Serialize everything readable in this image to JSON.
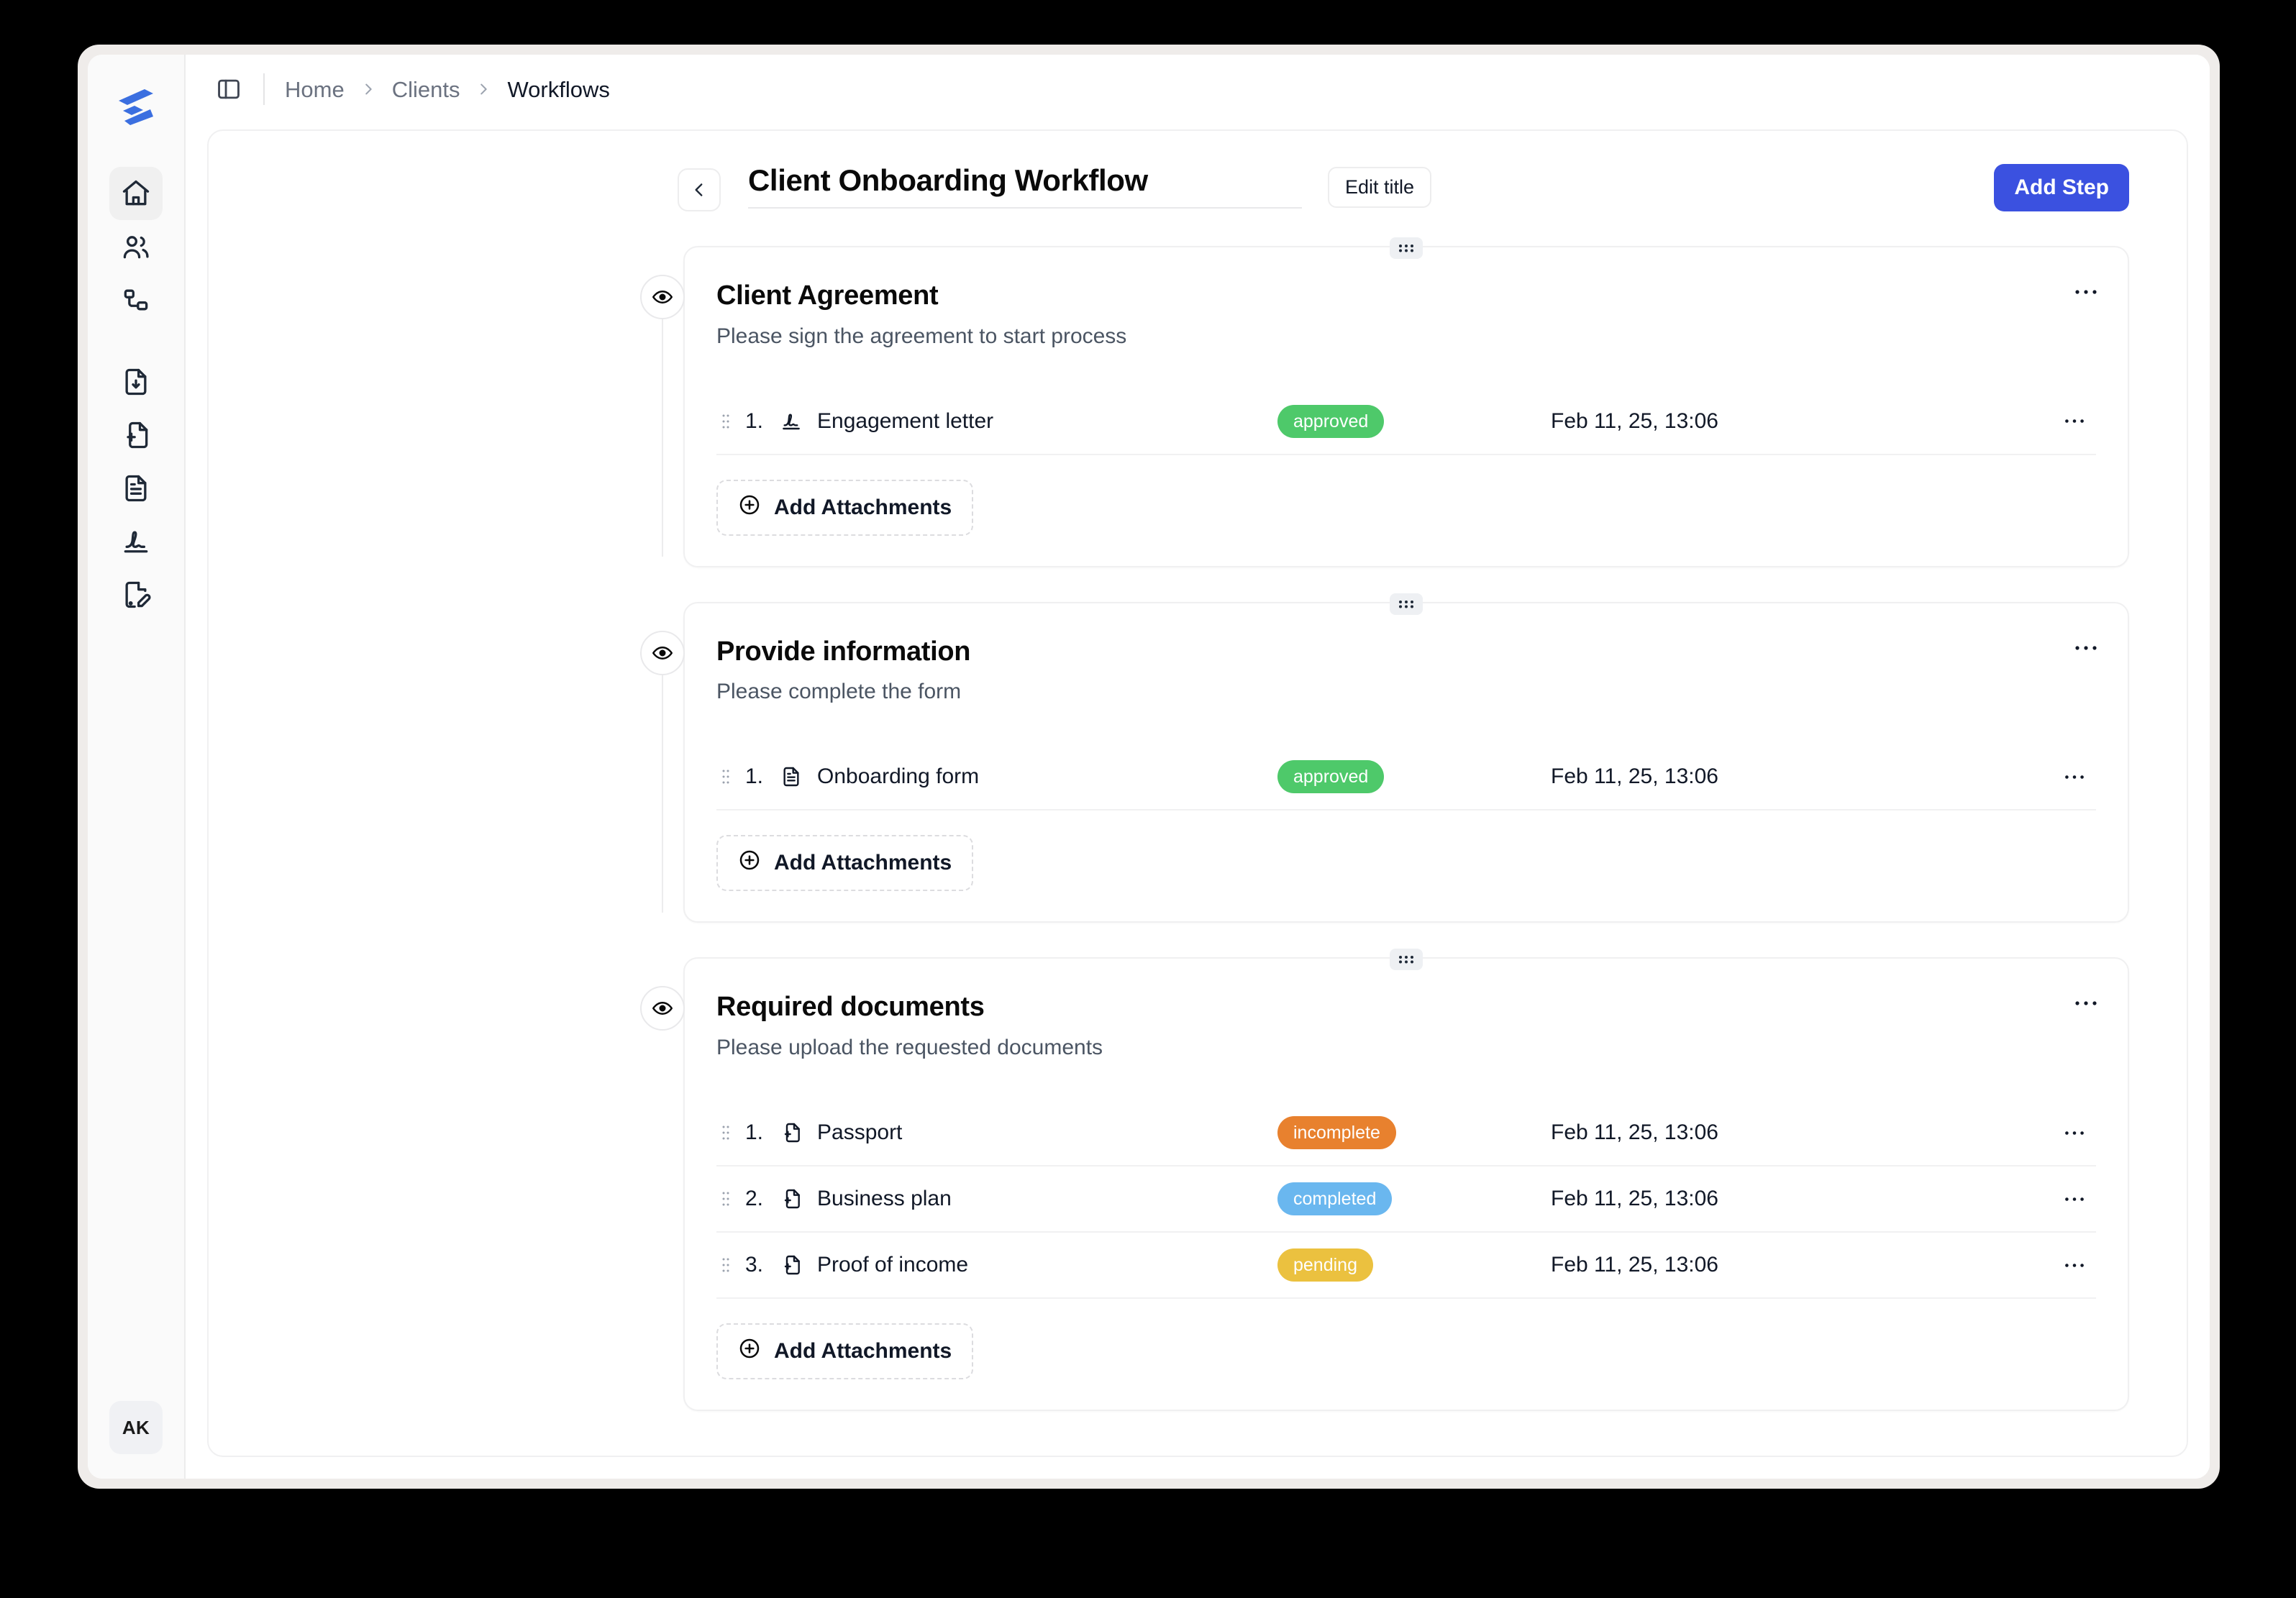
{
  "app": {
    "logo_name": "stacked-chevrons-logo",
    "accent_color": "#3b51e0",
    "user_initials": "AK"
  },
  "sidebar": {
    "items": [
      {
        "icon": "home-icon",
        "name": "home",
        "active": true
      },
      {
        "icon": "users-icon",
        "name": "clients",
        "active": false
      },
      {
        "icon": "workflow-nodes-icon",
        "name": "workflows",
        "active": false
      },
      {
        "icon": "file-download-icon",
        "name": "file-requests",
        "active": false
      },
      {
        "icon": "file-plus-icon",
        "name": "new-document",
        "active": false
      },
      {
        "icon": "file-text-icon",
        "name": "forms",
        "active": false
      },
      {
        "icon": "signature-icon",
        "name": "signatures",
        "active": false
      },
      {
        "icon": "file-edit-icon",
        "name": "templates",
        "active": false
      }
    ]
  },
  "topbar": {
    "panel_toggle_icon": "panel-left-icon",
    "breadcrumb": [
      {
        "label": "Home",
        "current": false
      },
      {
        "label": "Clients",
        "current": false
      },
      {
        "label": "Workflows",
        "current": true
      }
    ]
  },
  "page": {
    "back_icon": "chevron-left-icon",
    "title": "Client Onboarding Workflow",
    "edit_title_label": "Edit title",
    "add_step_label": "Add Step"
  },
  "steps": [
    {
      "title": "Client Agreement",
      "description": "Please sign the agreement to start process",
      "eye_icon": "eye-icon",
      "grip_icon": "grip-dots-icon",
      "menu_icon": "more-horizontal-icon",
      "add_attachments_label": "Add Attachments",
      "add_attachments_icon": "plus-circle-icon",
      "rows": [
        {
          "num": "1.",
          "icon": "signature-icon",
          "name": "Engagement letter",
          "status": "approved",
          "status_color": "#4ec96a",
          "date": "Feb 11, 25, 13:06"
        }
      ]
    },
    {
      "title": "Provide information",
      "description": "Please complete the form",
      "eye_icon": "eye-icon",
      "grip_icon": "grip-dots-icon",
      "menu_icon": "more-horizontal-icon",
      "add_attachments_label": "Add Attachments",
      "add_attachments_icon": "plus-circle-icon",
      "rows": [
        {
          "num": "1.",
          "icon": "file-text-icon",
          "name": "Onboarding form",
          "status": "approved",
          "status_color": "#4ec96a",
          "date": "Feb 11, 25, 13:06"
        }
      ]
    },
    {
      "title": "Required documents",
      "description": "Please upload the requested documents",
      "eye_icon": "eye-icon",
      "grip_icon": "grip-dots-icon",
      "menu_icon": "more-horizontal-icon",
      "add_attachments_label": "Add Attachments",
      "add_attachments_icon": "plus-circle-icon",
      "rows": [
        {
          "num": "1.",
          "icon": "file-plus-icon",
          "name": "Passport",
          "status": "incomplete",
          "status_color": "#e8812e",
          "date": "Feb 11, 25, 13:06"
        },
        {
          "num": "2.",
          "icon": "file-plus-icon",
          "name": "Business plan",
          "status": "completed",
          "status_color": "#6ab7ef",
          "date": "Feb 11, 25, 13:06"
        },
        {
          "num": "3.",
          "icon": "file-plus-icon",
          "name": "Proof of income",
          "status": "pending",
          "status_color": "#ebc13f",
          "date": "Feb 11, 25, 13:06"
        }
      ]
    }
  ]
}
